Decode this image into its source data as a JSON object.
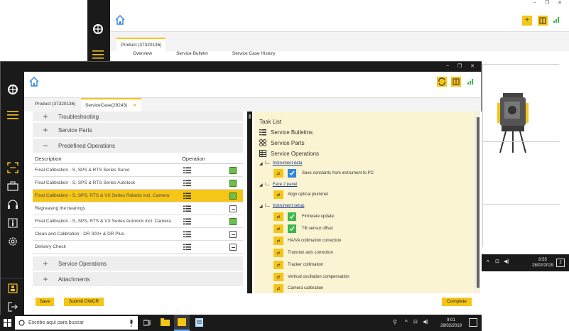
{
  "background_window": {
    "tab_product": "Product (37320136)",
    "subtabs": [
      "Overview",
      "Service Bulletin",
      "Service Case History"
    ],
    "clock_time": "8:55",
    "clock_date": "28/02/2019"
  },
  "foreground_window": {
    "tabs": [
      {
        "label": "Product (37320136)"
      },
      {
        "label": "ServiceCase(29243)"
      }
    ],
    "sections_top": [
      {
        "label": "Troubleshooting",
        "symbol": "+"
      },
      {
        "label": "Service Parts",
        "symbol": "+"
      },
      {
        "label": "Predefined Operations",
        "symbol": "−"
      }
    ],
    "operations_table": {
      "col_description": "Description",
      "col_operation": "Operation",
      "rows": [
        {
          "description": "Final Calibration - S, SPS & RTS Series Servo",
          "state": "green"
        },
        {
          "description": "Final Calibration - S, SPS & RTS Series Autolock",
          "state": "green"
        },
        {
          "description": "Final Calibration - S, SPS, RTS & VX Series Robotic incl. Camera",
          "state": "green"
        },
        {
          "description": "Regreasing the bearings",
          "state": "dash"
        },
        {
          "description": "Final Calibration - S, SPS, RTS & VX Series Autolock incl. Camera",
          "state": "green"
        },
        {
          "description": "Clean and Calibration - DR 300+ & DR Plus",
          "state": "dash"
        },
        {
          "description": "Delivery Check",
          "state": "dash"
        }
      ]
    },
    "sections_bottom": [
      {
        "label": "Service Operations",
        "symbol": "+"
      },
      {
        "label": "Attachments",
        "symbol": "+"
      }
    ],
    "task_list": {
      "title": "Task List",
      "links": [
        "Service Bulletins",
        "Service Parts",
        "Service Operations"
      ],
      "group_instrument_data": "Instrument data",
      "task_save_constants": "Save constants from instrument to PC",
      "group_face2": "Face 2 panel",
      "task_align": "Align optical plummet",
      "group_instrument_setup": "Instrument setup",
      "task_firmware": "Firmware update",
      "task_tilt": "Tilt sensor offset",
      "task_hzva": "HA/VA collimation correction",
      "task_trunnion": "Trunnion axis correction",
      "task_tracker": "Tracker collimation",
      "task_vertical": "Vertical oscillation compensation",
      "task_camera": "Camera calibration"
    },
    "buttons": {
      "save": "Save",
      "submit": "Submit DWCR",
      "complete": "Complete"
    }
  },
  "taskbar": {
    "search_placeholder": "Escribe aquí para buscar",
    "clock_time": "9:01",
    "clock_date": "28/02/2019"
  },
  "colors": {
    "accent": "#f5c518",
    "dark": "#1a1a1a",
    "task_bg": "#fbf4d3",
    "check_green": "#3cb84a",
    "check_blue": "#2e86de",
    "link_blue": "#1d3c8f"
  }
}
